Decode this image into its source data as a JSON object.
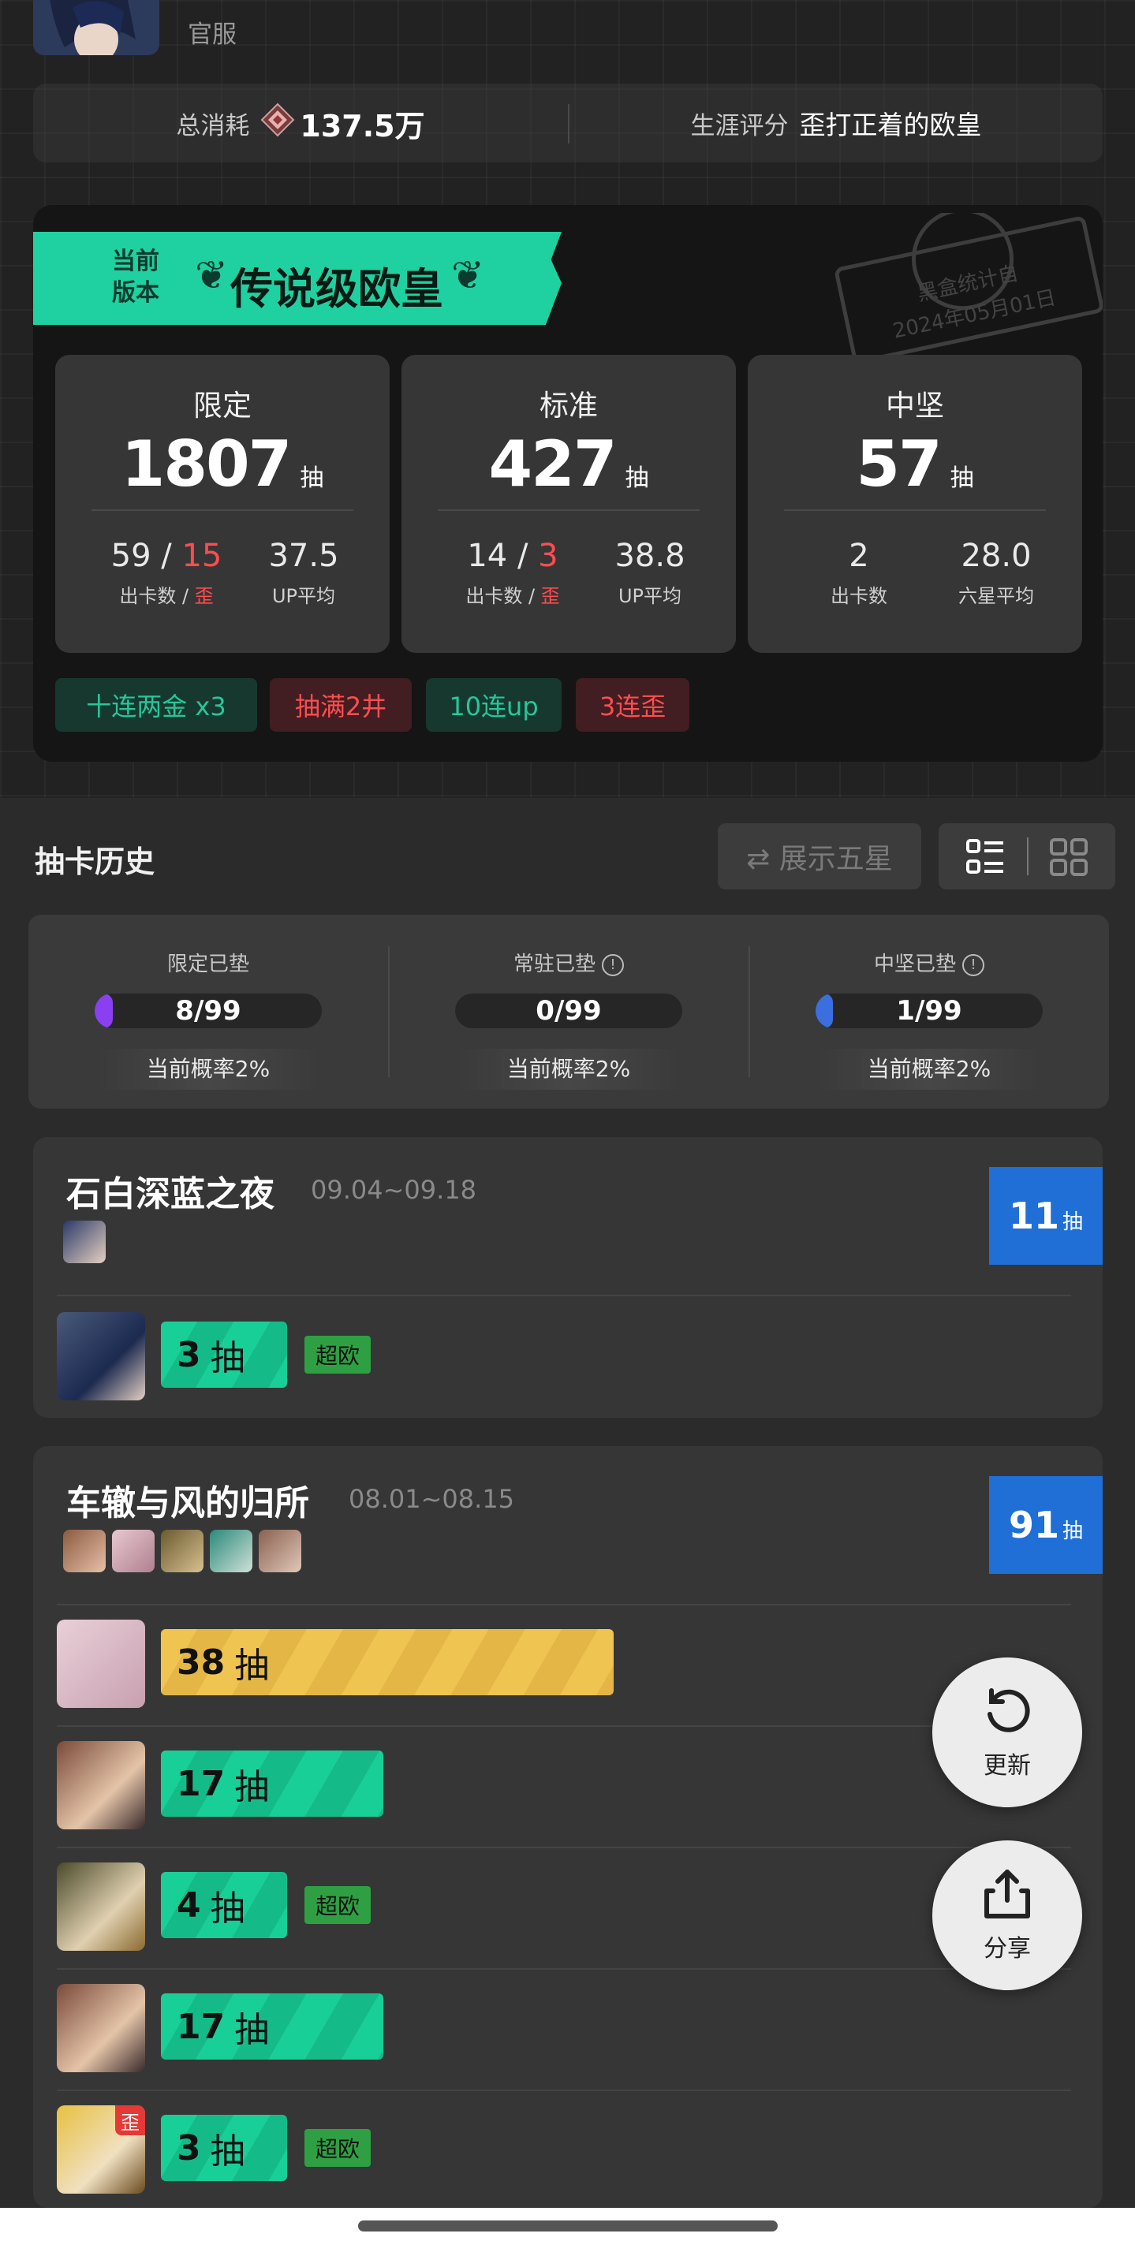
{
  "header": {
    "server": "官服"
  },
  "stats": {
    "consume_label": "总消耗",
    "consume_value": "137.5万",
    "score_label": "生涯评分",
    "score_value": "歪打正着的欧皇"
  },
  "summary": {
    "banner_small_1": "当前",
    "banner_small_2": "版本",
    "banner_title": "传说级欧皇",
    "stamp_line1": "黑盒统计自",
    "stamp_line2": "2024年05月01日",
    "pools": [
      {
        "name": "限定",
        "count": "1807",
        "unit": "抽",
        "stat1_a": "59",
        "stat1_sep": " / ",
        "stat1_b": "15",
        "stat1_label_a": "出卡数 / ",
        "stat1_label_b": "歪",
        "stat2": "37.5",
        "stat2_label": "UP平均"
      },
      {
        "name": "标准",
        "count": "427",
        "unit": "抽",
        "stat1_a": "14",
        "stat1_sep": " / ",
        "stat1_b": "3",
        "stat1_label_a": "出卡数 / ",
        "stat1_label_b": "歪",
        "stat2": "38.8",
        "stat2_label": "UP平均"
      },
      {
        "name": "中坚",
        "count": "57",
        "unit": "抽",
        "stat1_a": "2",
        "stat1_label_a": "出卡数",
        "stat2": "28.0",
        "stat2_label": "六星平均"
      }
    ],
    "tags": [
      {
        "text": "十连两金 x3",
        "color": "green"
      },
      {
        "text": "抽满2井",
        "color": "red"
      },
      {
        "text": "10连up",
        "color": "green"
      },
      {
        "text": "3连歪",
        "color": "red"
      }
    ]
  },
  "history": {
    "title": "抽卡历史",
    "show5_label": "⇄ 展示五星",
    "view_icons": [
      "list-view-icon",
      "grid-view-icon"
    ]
  },
  "pity": [
    {
      "label": "限定已垫",
      "value": "8/99",
      "progress": 0.0808,
      "color": "#8a3ff0",
      "prob": "当前概率2%",
      "info": false
    },
    {
      "label": "常驻已垫",
      "value": "0/99",
      "progress": 0,
      "color": "#3b6fe0",
      "prob": "当前概率2%",
      "info": true
    },
    {
      "label": "中坚已垫",
      "value": "1/99",
      "progress": 0.0101,
      "color": "#3b6fe0",
      "prob": "当前概率2%",
      "info": true
    }
  ],
  "banners": [
    {
      "title": "石白深蓝之夜",
      "dates": "09.04~09.18",
      "total": "11",
      "total_unit": "抽",
      "pulls": [
        {
          "count": "3",
          "unit": "抽",
          "max": 99,
          "color": "green",
          "badge": "超欧",
          "wai": false
        }
      ]
    },
    {
      "title": "车辙与风的归所",
      "dates": "08.01~08.15",
      "total": "91",
      "total_unit": "抽",
      "pulls": [
        {
          "count": "38",
          "unit": "抽",
          "max": 99,
          "color": "yellow",
          "badge": "",
          "wai": false
        },
        {
          "count": "17",
          "unit": "抽",
          "max": 99,
          "color": "green",
          "badge": "",
          "wai": false
        },
        {
          "count": "4",
          "unit": "抽",
          "max": 99,
          "color": "green",
          "badge": "超欧",
          "wai": false
        },
        {
          "count": "17",
          "unit": "抽",
          "max": 99,
          "color": "green",
          "badge": "",
          "wai": false
        },
        {
          "count": "3",
          "unit": "抽",
          "max": 99,
          "color": "green",
          "badge": "超欧",
          "wai": true,
          "wai_text": "歪"
        }
      ]
    }
  ],
  "fabs": {
    "refresh": "更新",
    "share": "分享"
  }
}
